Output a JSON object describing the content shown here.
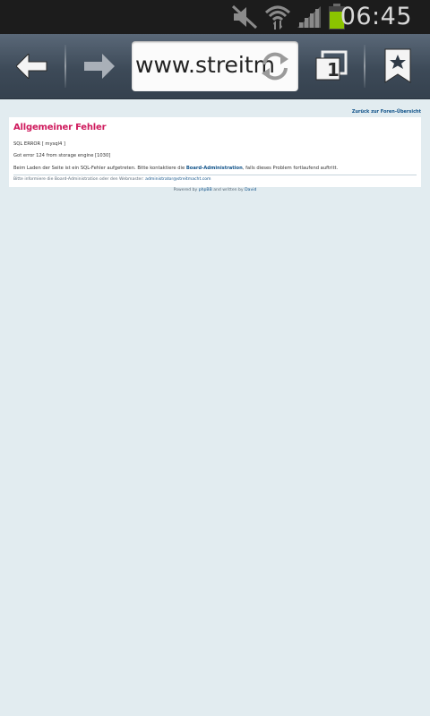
{
  "status_bar": {
    "time": "06:45",
    "icons": [
      "mute-icon",
      "wifi-icon",
      "signal-icon",
      "battery-icon"
    ],
    "battery_color": "#8bc400"
  },
  "browser": {
    "url": "www.streitm",
    "tab_count": "1",
    "icons": [
      "back-arrow-icon",
      "forward-arrow-icon",
      "reload-icon",
      "windows-icon",
      "bookmark-icon"
    ]
  },
  "page": {
    "back_link": "Zurück zur Foren-Übersicht",
    "title": "Allgemeiner Fehler",
    "sql_error": "SQL ERROR [ mysql4 ]",
    "engine_error": "Got error 124 from storage engine [1030]",
    "message_before": "Beim Laden der Seite ist ein SQL-Fehler aufgetreten. Bitte kontaktiere die ",
    "message_link": "Board-Administration",
    "message_after": ", falls dieses Problem fortlaufend auftritt.",
    "notice_text": "Bitte informiere die Board-Administration oder den Webmaster: ",
    "notice_email": "administrator@streitmacht.com",
    "powered_before": "Powered by ",
    "powered_link": "phpBB",
    "powered_middle": " and written by ",
    "powered_author": "David"
  },
  "colors": {
    "title": "#cf1a5d",
    "link": "#105289",
    "background": "#e2ecf0"
  }
}
